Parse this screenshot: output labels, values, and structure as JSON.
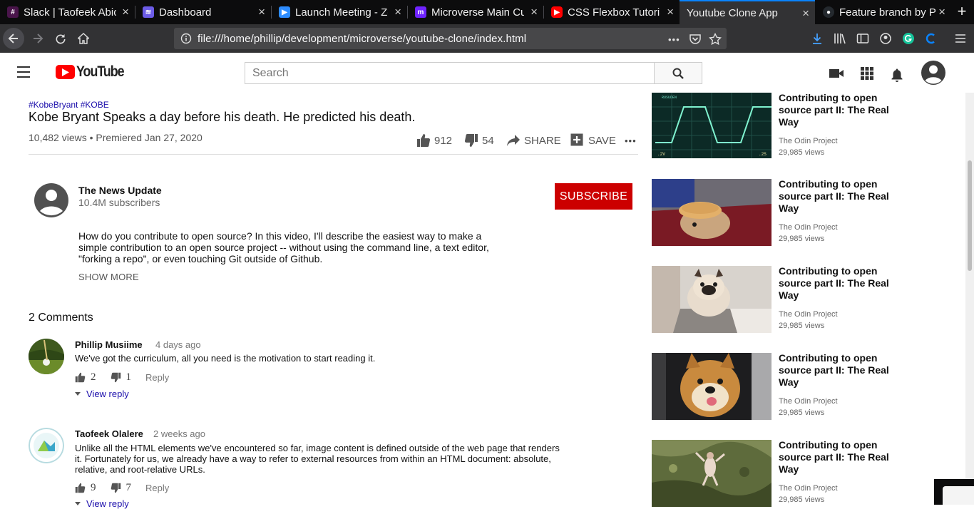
{
  "browser": {
    "tabs": [
      {
        "label": "Slack | Taofeek Abio",
        "icon": "slack-icon",
        "color": "#4a154b",
        "glyph": "#"
      },
      {
        "label": "Dashboard",
        "icon": "dashboard-icon",
        "color": "#6c5ce7",
        "glyph": "≋"
      },
      {
        "label": "Launch Meeting - Zo",
        "icon": "zoom-icon",
        "color": "#2d8cff",
        "glyph": "▶"
      },
      {
        "label": "Microverse Main Cu",
        "icon": "microverse-icon",
        "color": "#6f23ff",
        "glyph": "m"
      },
      {
        "label": "CSS Flexbox Tutoria",
        "icon": "youtube-icon",
        "color": "#ff0000",
        "glyph": "▶"
      },
      {
        "label": "Youtube Clone App",
        "icon": "none",
        "color": "",
        "glyph": ""
      },
      {
        "label": "Feature branch by P",
        "icon": "github-icon",
        "color": "#24292e",
        "glyph": "●"
      }
    ],
    "active_tab": 5,
    "url": "file:///home/phillip/development/microverse/youtube-clone/index.html",
    "close_glyph": "×",
    "new_tab_glyph": "+",
    "url_more_glyph": "•••"
  },
  "header": {
    "logo_text": "YouTube",
    "search_placeholder": "Search"
  },
  "video": {
    "hashtags": "#KobeBryant #KOBE",
    "title": "Kobe Bryant Speaks a day before his death. He predicted his death.",
    "meta": "10,482 views • Premiered Jan 27, 2020",
    "likes": "912",
    "dislikes": "54",
    "share_label": "SHARE",
    "save_label": "SAVE",
    "more_glyph": "•••"
  },
  "channel": {
    "name": "The News Update",
    "subscribers": "10.4M subscribers",
    "subscribe_label": "SUBSCRIBE",
    "description": "How do you contribute to open source? In this video, I'll describe the easiest way to make a simple contribution to an open source project -- without using the command line, a text editor, \"forking a repo\", or even touching Git outside of Github.",
    "show_more": "SHOW MORE"
  },
  "comments": {
    "count_label": "2 Comments",
    "items": [
      {
        "author": "Phillip Musiime",
        "time": "4 days ago",
        "text": "We've got the curriculum, all you need is the motivation to start reading it.",
        "likes": "2",
        "dislikes": "1",
        "reply": "Reply",
        "view_reply": "View reply"
      },
      {
        "author": "Taofeek Olalere",
        "time": "2 weeks ago",
        "text": "Unlike all the HTML elements we've encountered so far, image content is defined outside of the web page that renders it. Fortunately for us, we already have a way to refer to external resources from within an HTML document: absolute, relative, and root-relative URLs.",
        "likes": "9",
        "dislikes": "7",
        "reply": "Reply",
        "view_reply": "View reply"
      }
    ]
  },
  "sidebar": {
    "items": [
      {
        "title": "Contributing to open source part II: The Real Way",
        "channel": "The Odin Project",
        "views": "29,985 views",
        "thumb": "oscilloscope"
      },
      {
        "title": "Contributing to open source part II: The Real Way",
        "channel": "The Odin Project",
        "views": "29,985 views",
        "thumb": "rabbit-pancake"
      },
      {
        "title": "Contributing to open source part II: The Real Way",
        "channel": "The Odin Project",
        "views": "29,985 views",
        "thumb": "pug"
      },
      {
        "title": "Contributing to open source part II: The Real Way",
        "channel": "The Odin Project",
        "views": "29,985 views",
        "thumb": "shiba-dog"
      },
      {
        "title": "Contributing to open source part II: The Real Way",
        "channel": "The Odin Project",
        "views": "29,985 views",
        "thumb": "aerial-person"
      }
    ]
  },
  "colors": {
    "brand_red": "#ff0000",
    "subscribe_red": "#cc0000",
    "link_blue": "#1a0dab",
    "browser_accent": "#0a84ff"
  }
}
